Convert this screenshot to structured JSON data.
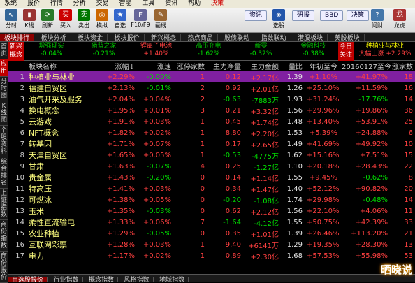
{
  "menu": [
    "系统",
    "报价",
    "行情",
    "分析",
    "交易",
    "智能",
    "工具",
    "资讯",
    "帮助",
    "决策"
  ],
  "toolbar": {
    "buttons": [
      {
        "label": "分时",
        "icon": "chart-icon"
      },
      {
        "label": "K线",
        "icon": "kline-icon"
      },
      {
        "label": "刷新",
        "icon": "refresh-icon"
      },
      {
        "label": "买入",
        "icon": "buy-icon"
      },
      {
        "label": "卖出",
        "icon": "sell-icon"
      },
      {
        "label": "模拟",
        "icon": "simulate-icon"
      },
      {
        "label": "自选",
        "icon": "watchlist-icon"
      },
      {
        "label": "F10/F9",
        "icon": "f10-icon"
      },
      {
        "label": "画线",
        "icon": "draw-icon"
      }
    ],
    "news_label": "资讯",
    "select_label": "选股",
    "research_label": "研报",
    "bbd_label": "BBD",
    "jieguo_label": "决策",
    "right_labels": [
      "问财",
      "龙虎"
    ]
  },
  "tabs": [
    "板块排行",
    "板块分析",
    "板块资金",
    "板块报价",
    "新兴概念",
    "热点商品",
    "股债联动",
    "指数联动",
    "港股板块",
    "美股板块"
  ],
  "sidebar": [
    "首页",
    "应用",
    "分时图",
    "K线图",
    "个股资料",
    "综合排名",
    "上证指数",
    "商份指数",
    "商份报价"
  ],
  "summary": {
    "first_label": "新兴概念",
    "items": [
      {
        "name": "增强现实",
        "val": "-0.04%"
      },
      {
        "name": "猪蓝之家",
        "val": "-0.21%"
      },
      {
        "name": "锂离子电池",
        "val": "+1.40%"
      },
      {
        "name": "高压充电",
        "val": "-1.62%"
      },
      {
        "name": "新零",
        "val": "-0.32%"
      },
      {
        "name": "金融科技",
        "val": "-0.38%"
      }
    ],
    "today_label": "今日关注",
    "right_name": "种植业与林业",
    "right_val": "大幅上涨 +2.29%"
  },
  "table": {
    "headers": [
      "",
      "板块名称",
      "涨幅↓",
      "涨速",
      "涨停家数",
      "主力净量",
      "主力金额",
      "量比",
      "年初至今",
      "20160127至今",
      "涨家数"
    ],
    "rows": [
      [
        "1",
        "种植业与林业",
        "+2.29%",
        "-0.00%",
        "1",
        "0.12",
        "+2.17亿",
        "1.39",
        "+1.10%",
        "+41.97%",
        "18"
      ],
      [
        "2",
        "福建自贸区",
        "+2.13%",
        "-0.01%",
        "2",
        "0.92",
        "+2.01亿",
        "1.26",
        "+25.10%",
        "+11.59%",
        "16"
      ],
      [
        "3",
        "油气开采及服务",
        "+2.04%",
        "+0.04%",
        "2",
        "-0.63",
        "-7883万",
        "1.93",
        "+31.24%",
        "-17.76%",
        "14"
      ],
      [
        "4",
        "换电概念",
        "+1.95%",
        "+0.01%",
        "3",
        "0.21",
        "+3.32亿",
        "1.56",
        "+29.96%",
        "+19.86%",
        "36"
      ],
      [
        "5",
        "云游戏",
        "+1.91%",
        "+0.03%",
        "1",
        "0.45",
        "+1.74亿",
        "1.48",
        "+13.40%",
        "+53.91%",
        "25"
      ],
      [
        "6",
        "NFT概念",
        "+1.82%",
        "+0.02%",
        "1",
        "8.80",
        "+2.20亿",
        "1.53",
        "+5.39%",
        "+24.88%",
        "6"
      ],
      [
        "7",
        "转基因",
        "+1.71%",
        "+0.07%",
        "1",
        "0.17",
        "+2.65亿",
        "1.49",
        "+41.69%",
        "+49.92%",
        "10"
      ],
      [
        "8",
        "天津自贸区",
        "+1.65%",
        "+0.05%",
        "1",
        "-0.53",
        "-4775万",
        "1.62",
        "+15.16%",
        "+7.51%",
        "15"
      ],
      [
        "9",
        "甘肃",
        "+1.63%",
        "-0.07%",
        "4",
        "0.25",
        "-1.27亿",
        "1.10",
        "+20.18%",
        "+28.43%",
        "22"
      ],
      [
        "10",
        "贵金属",
        "+1.43%",
        "-0.20%",
        "0",
        "0.14",
        "+1.14亿",
        "1.55",
        "+9.45%",
        "-0.62%",
        "8"
      ],
      [
        "11",
        "特高压",
        "+1.41%",
        "+0.03%",
        "0",
        "0.34",
        "+1.47亿",
        "1.40",
        "+52.12%",
        "+90.82%",
        "20"
      ],
      [
        "12",
        "可燃冰",
        "+1.38%",
        "+0.05%",
        "0",
        "-0.20",
        "-1.08亿",
        "1.74",
        "+29.98%",
        "-0.48%",
        "14"
      ],
      [
        "13",
        "玉米",
        "+1.35%",
        "-0.03%",
        "0",
        "0.62",
        "+2.12亿",
        "1.56",
        "+22.10%",
        "+4.06%",
        "11"
      ],
      [
        "14",
        "柔性直流输电",
        "+1.33%",
        "+0.06%",
        "7",
        "-1.64",
        "-4.12亿",
        "1.55",
        "+50.75%",
        "+42.39%",
        "33"
      ],
      [
        "15",
        "农业种植",
        "+1.29%",
        "-0.05%",
        "0",
        "0.35",
        "+1.01亿",
        "1.39",
        "+26.46%",
        "+113.20%",
        "21"
      ],
      [
        "16",
        "互联网彩票",
        "+1.28%",
        "+0.03%",
        "1",
        "9.40",
        "+6141万",
        "1.29",
        "+19.35%",
        "+28.30%",
        "13"
      ],
      [
        "17",
        "电力",
        "+1.17%",
        "+0.02%",
        "1",
        "0.89",
        "+2.30亿",
        "1.68",
        "+57.53%",
        "+55.98%",
        "53"
      ]
    ]
  },
  "bottom_tabs": [
    "自选股报价",
    "行业指数",
    "概念指数",
    "风格指数",
    "地域指数"
  ],
  "watermark": "晒晓说"
}
